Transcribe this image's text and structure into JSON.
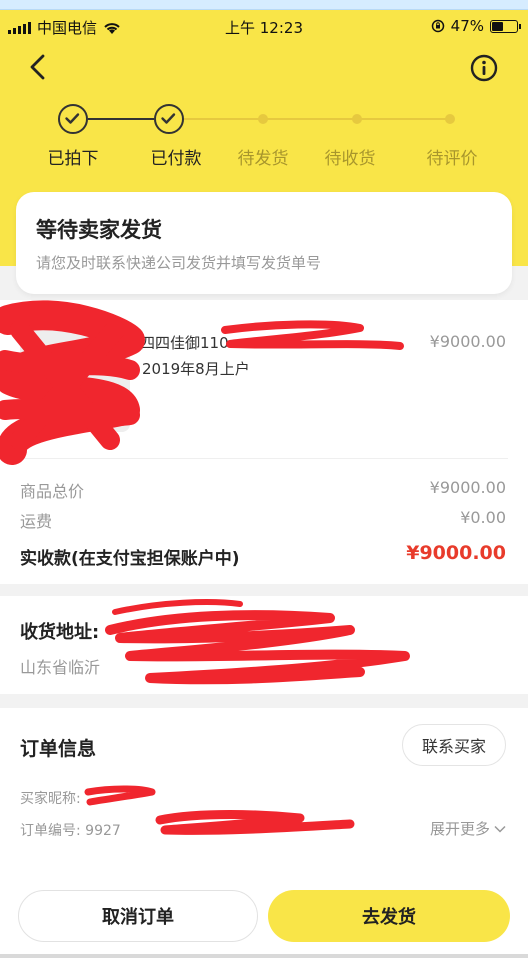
{
  "status_bar": {
    "carrier": "中国电信",
    "time": "上午 12:23",
    "battery_percent": "47%",
    "battery_level": 0.47
  },
  "header": {
    "back_icon": "chevron-left-icon",
    "info_icon": "info-circle-icon"
  },
  "steps": [
    {
      "label": "已拍下",
      "state": "done"
    },
    {
      "label": "已付款",
      "state": "done"
    },
    {
      "label": "待发货",
      "state": "pending"
    },
    {
      "label": "待收货",
      "state": "pending"
    },
    {
      "label": "待评价",
      "state": "pending"
    }
  ],
  "status_card": {
    "title": "等待卖家发货",
    "subtitle": "请您及时联系快递公司发货并填写发货单号"
  },
  "product": {
    "title": "四四佳御110",
    "date": "2019年8月上户",
    "price": "¥9000.00"
  },
  "price_summary": {
    "total_label": "商品总价",
    "total_value": "¥9000.00",
    "shipping_label": "运费",
    "shipping_value": "¥0.00",
    "paid_label": "实收款(在支付宝担保账户中)",
    "paid_value": "¥9000.00"
  },
  "address": {
    "label": "收货地址:",
    "text": "山东省临沂"
  },
  "order_info": {
    "title": "订单信息",
    "contact_button": "联系买家",
    "buyer_nick_label": "买家昵称:",
    "order_no_label": "订单编号: 9927",
    "expand_label": "展开更多"
  },
  "actions": {
    "cancel_label": "取消订单",
    "ship_label": "去发货"
  },
  "colors": {
    "brand_yellow": "#f9e548",
    "price_red": "#e83b2b",
    "redaction_red": "#f0262e"
  }
}
